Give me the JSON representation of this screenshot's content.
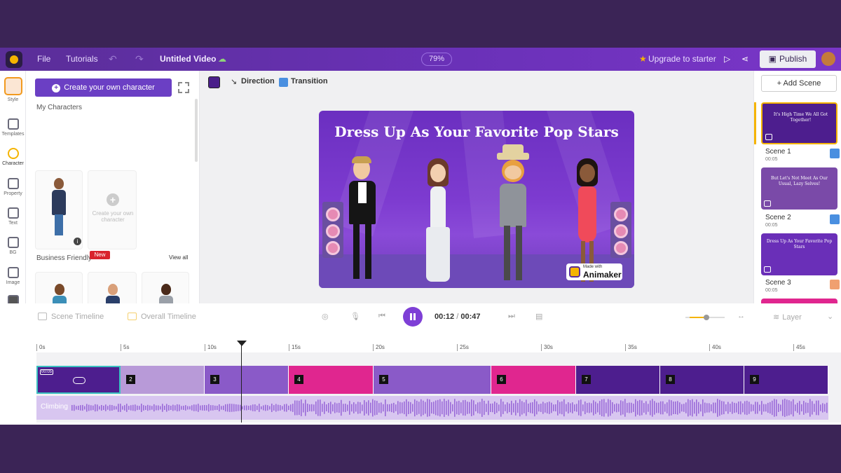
{
  "topbar": {
    "file": "File",
    "tutorials": "Tutorials",
    "title": "Untitled Video",
    "zoom": "79%",
    "upgrade": "Upgrade to starter",
    "publish": "Publish"
  },
  "rail": {
    "items": [
      {
        "label": "Style",
        "icon": "avatar-icon"
      },
      {
        "label": "Templates",
        "icon": "templates-icon"
      },
      {
        "label": "Character",
        "icon": "character-icon"
      },
      {
        "label": "Property",
        "icon": "property-icon"
      },
      {
        "label": "Text",
        "icon": "text-icon"
      },
      {
        "label": "BG",
        "icon": "layers-icon"
      },
      {
        "label": "Image",
        "icon": "image-icon"
      },
      {
        "label": "",
        "icon": "video-icon"
      }
    ]
  },
  "panel": {
    "create_button": "Create your own character",
    "my_characters": "My Characters",
    "create_placeholder": "Create your own character",
    "business_friendly": "Business Friendly",
    "view_all": "View all",
    "new_badge": "New"
  },
  "canvas_toolbar": {
    "direction": "Direction",
    "transition": "Transition"
  },
  "stage": {
    "title": "Dress Up As Your Favorite Pop Stars",
    "watermark_small": "Made with",
    "watermark_brand": "Animaker"
  },
  "scenes": {
    "add_scene": "+ Add Scene",
    "items": [
      {
        "name": "Scene 1",
        "duration": "00:05",
        "thumb_text": "It's High Time We All Got Together!"
      },
      {
        "name": "Scene 2",
        "duration": "00:05",
        "thumb_text": "But Let's Not Meet As Our Usual, Lazy Selves!"
      },
      {
        "name": "Scene 3",
        "duration": "00:05",
        "thumb_text": "Dress Up As Your Favorite Pop Stars"
      }
    ]
  },
  "timeline": {
    "scene_timeline": "Scene Timeline",
    "overall_timeline": "Overall Timeline",
    "current_time": "00:12",
    "separator": "/",
    "total_time": "00:47",
    "layer": "Layer",
    "ruler": [
      "0s",
      "5s",
      "10s",
      "15s",
      "20s",
      "25s",
      "30s",
      "35s",
      "40s",
      "45s"
    ],
    "clip1_duration": "00:05",
    "clips": [
      "",
      "2",
      "3",
      "4",
      "5",
      "6",
      "7",
      "8",
      "9"
    ],
    "audio_label": "Climbing"
  },
  "colors": {
    "brand_purple": "#6b3fc4",
    "accent_pink": "#e0268f",
    "accent_yellow": "#f5b400"
  }
}
